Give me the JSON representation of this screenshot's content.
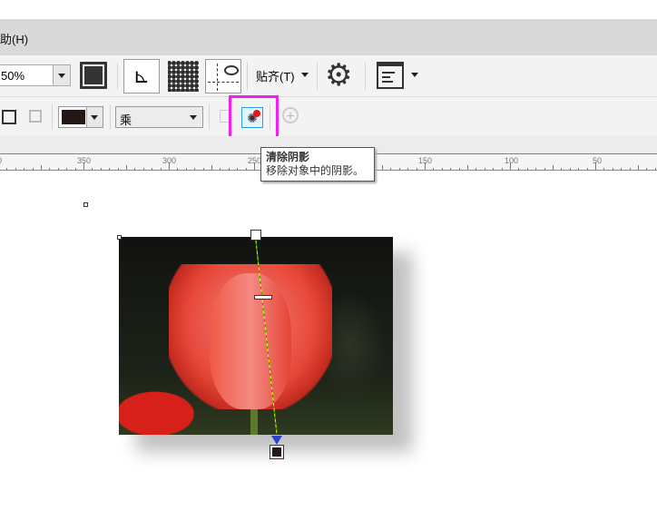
{
  "menu": {
    "help": "助(H)"
  },
  "toolbar1": {
    "zoom_value": "50%",
    "snap_label": "贴齐(T)",
    "icons": [
      "full-screen-icon",
      "rulers-icon",
      "grid-icon",
      "guidelines-icon",
      "settings-icon",
      "window-icon"
    ]
  },
  "toolbar2": {
    "blend_mode": "乘",
    "shadow_color": "#231815",
    "icons": [
      "shadow-direction-icon",
      "copy-shadow-icon",
      "shadow-clone-icon",
      "clear-shadow-icon",
      "add-icon"
    ]
  },
  "tooltip": {
    "title": "清除阴影",
    "description": "移除对象中的阴影。"
  },
  "ruler": {
    "labels": [
      "0",
      "350",
      "300",
      "250",
      "150",
      "100",
      "50"
    ]
  },
  "colors": {
    "highlight": "#f020f0",
    "accent": "#2b9be0"
  }
}
